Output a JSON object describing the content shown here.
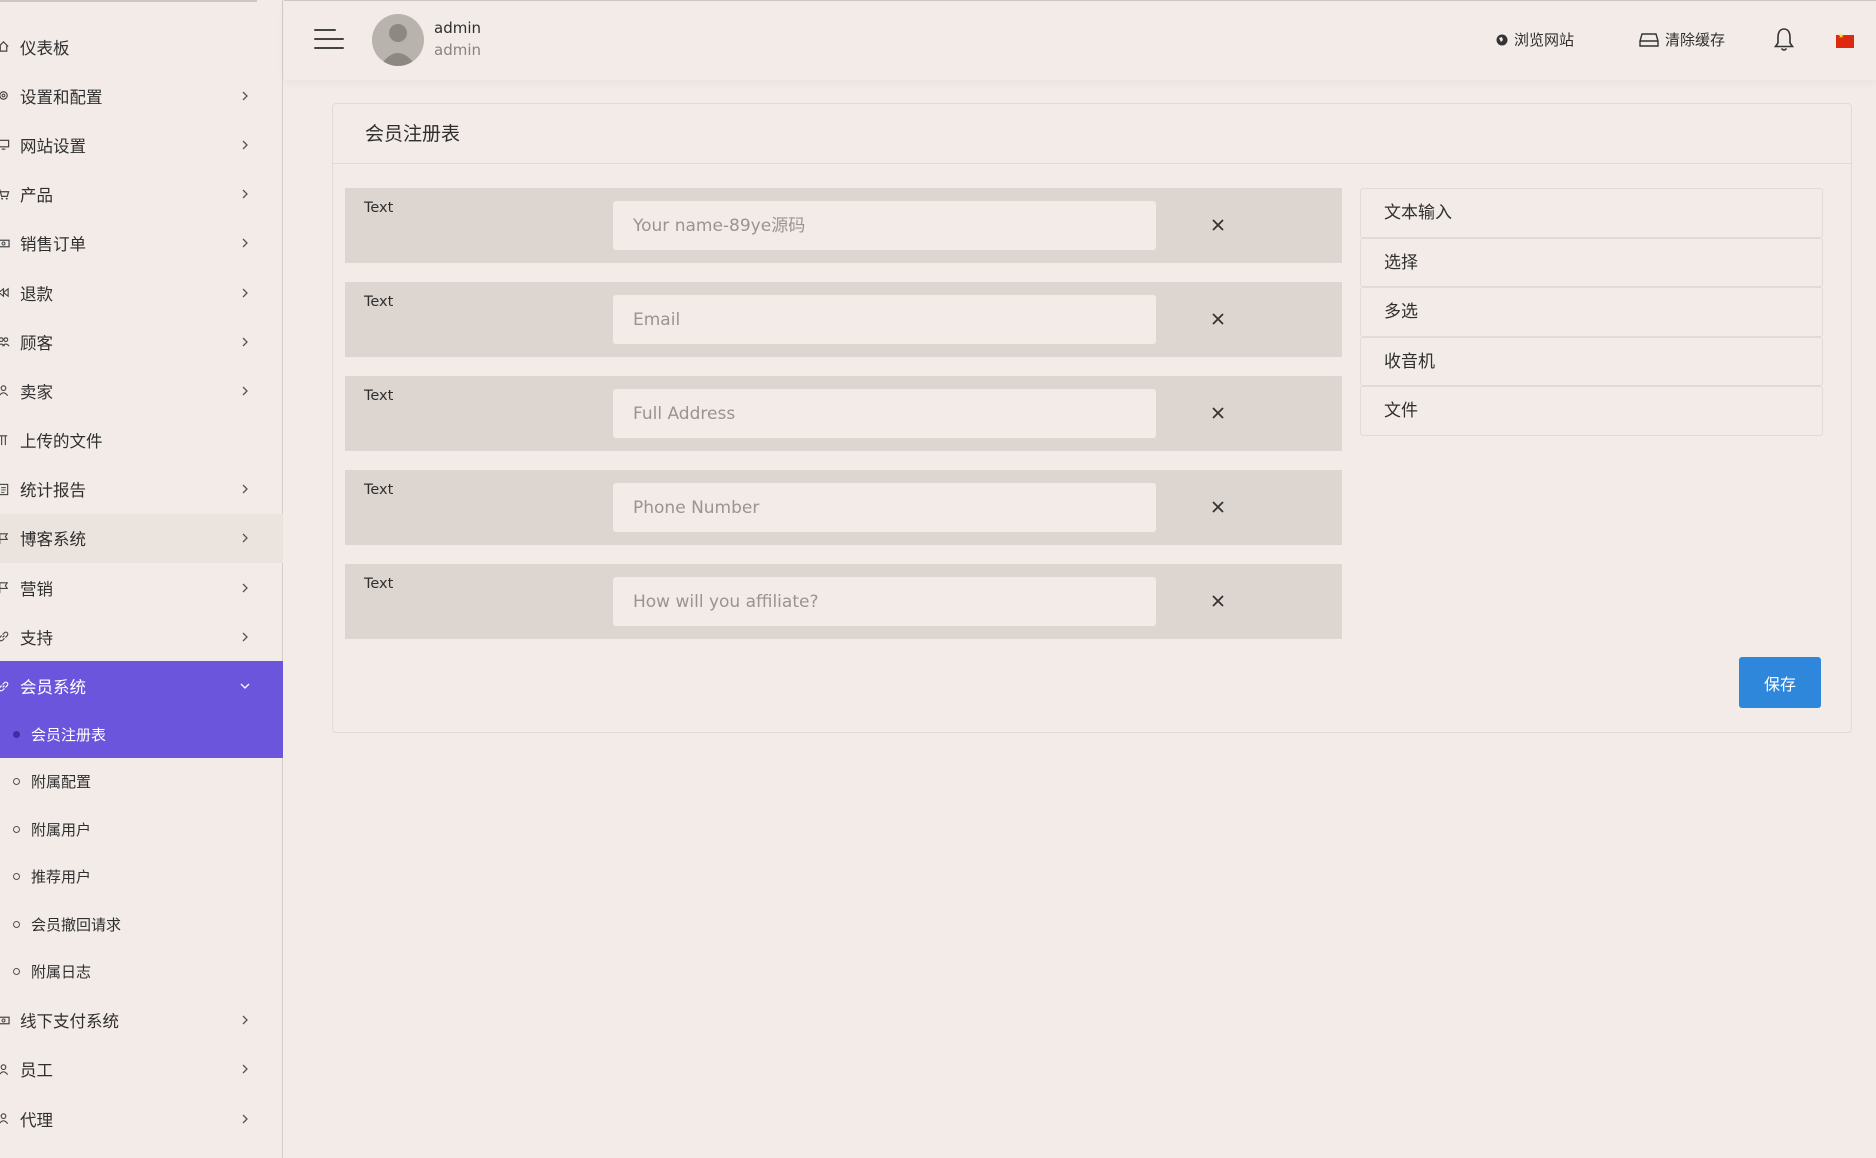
{
  "sidebar": {
    "items": [
      {
        "label": "仪表板",
        "icon": "home-icon",
        "chevron": false
      },
      {
        "label": "设置和配置",
        "icon": "gear-icon",
        "chevron": true
      },
      {
        "label": "网站设置",
        "icon": "monitor-icon",
        "chevron": true
      },
      {
        "label": "产品",
        "icon": "cart-icon",
        "chevron": true
      },
      {
        "label": "销售订单",
        "icon": "money-icon",
        "chevron": true
      },
      {
        "label": "退款",
        "icon": "rewind-icon",
        "chevron": true
      },
      {
        "label": "顾客",
        "icon": "users-icon",
        "chevron": true
      },
      {
        "label": "卖家",
        "icon": "user-icon",
        "chevron": true
      },
      {
        "label": "上传的文件",
        "icon": "folder-icon",
        "chevron": false
      },
      {
        "label": "统计报告",
        "icon": "report-icon",
        "chevron": true
      },
      {
        "label": "博客系统",
        "icon": "flag-icon",
        "chevron": true
      },
      {
        "label": "营销",
        "icon": "flag-icon",
        "chevron": true
      },
      {
        "label": "支持",
        "icon": "link-icon",
        "chevron": true
      },
      {
        "label": "会员系统",
        "icon": "link-icon",
        "chevron": true
      }
    ],
    "submenu": [
      {
        "label": "会员注册表"
      },
      {
        "label": "附属配置"
      },
      {
        "label": "附属用户"
      },
      {
        "label": "推荐用户"
      },
      {
        "label": "会员撤回请求"
      },
      {
        "label": "附属日志"
      }
    ],
    "bottom_items": [
      {
        "label": "线下支付系统",
        "icon": "money-icon"
      },
      {
        "label": "员工",
        "icon": "user-icon"
      },
      {
        "label": "代理",
        "icon": "user-icon"
      }
    ]
  },
  "header": {
    "user_name": "admin",
    "user_role": "admin",
    "browse_site": "浏览网站",
    "clear_cache": "清除缓存"
  },
  "card": {
    "title": "会员注册表",
    "fields": [
      {
        "type": "Text",
        "placeholder": "Your name-89ye源码"
      },
      {
        "type": "Text",
        "placeholder": "Email"
      },
      {
        "type": "Text",
        "placeholder": "Full Address"
      },
      {
        "type": "Text",
        "placeholder": "Phone Number"
      },
      {
        "type": "Text",
        "placeholder": "How will you affiliate?"
      }
    ],
    "options": [
      "文本输入",
      "选择",
      "多选",
      "收音机",
      "文件"
    ],
    "save_label": "保存"
  },
  "colors": {
    "accent": "#6a55dc",
    "primary_button": "#2f87db",
    "background": "#f2ebe7",
    "field_row": "#ddd5d0"
  }
}
